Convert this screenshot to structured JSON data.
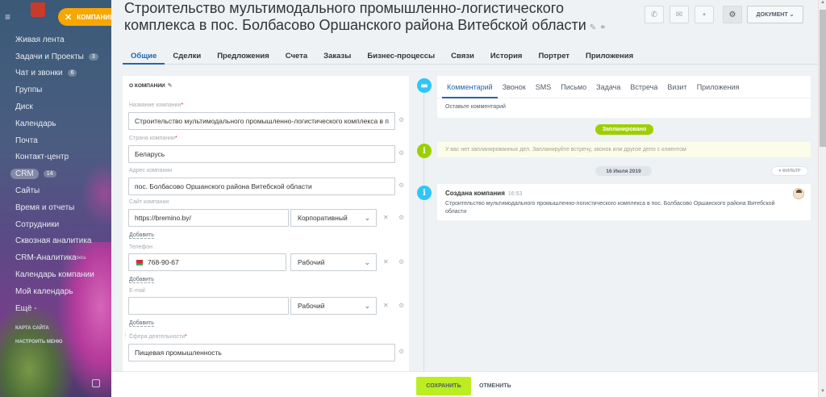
{
  "sidebar": {
    "company_pill": "КОМПАНИЯ",
    "items": [
      {
        "label": "Живая лента",
        "count": ""
      },
      {
        "label": "Задачи и Проекты",
        "count": "3"
      },
      {
        "label": "Чат и звонки",
        "count": "6"
      },
      {
        "label": "Группы",
        "count": ""
      },
      {
        "label": "Диск",
        "count": ""
      },
      {
        "label": "Календарь",
        "count": ""
      },
      {
        "label": "Почта",
        "count": ""
      },
      {
        "label": "Контакт-центр",
        "count": ""
      },
      {
        "label": "CRM",
        "count": "14"
      },
      {
        "label": "Сайты",
        "count": ""
      },
      {
        "label": "Время и отчеты",
        "count": ""
      },
      {
        "label": "Сотрудники",
        "count": ""
      },
      {
        "label": "Сквозная аналитика",
        "count": ""
      },
      {
        "label": "CRM-Аналитика",
        "count": "",
        "sup": "beta"
      },
      {
        "label": "Календарь компании",
        "count": ""
      },
      {
        "label": "Мой календарь",
        "count": ""
      },
      {
        "label": "Ещё -",
        "count": ""
      }
    ],
    "site_map": "КАРТА САЙТА",
    "setup_menu": "НАСТРОИТЬ МЕНЮ"
  },
  "header": {
    "title": "Строительство мультимодального промышленно-логистического комплекса в пос. Болбасово Оршанского района Витебской области",
    "document_button": "ДОКУМЕНТ"
  },
  "tabs": [
    "Общие",
    "Сделки",
    "Предложения",
    "Счета",
    "Заказы",
    "Бизнес-процессы",
    "Связи",
    "История",
    "Портрет",
    "Приложения"
  ],
  "about": {
    "section_title": "О КОМПАНИИ",
    "name_label": "Название компании",
    "name_value": "Строительство мультимодального промышленно-логистического комплекса в п",
    "country_label": "Страна компании",
    "country_value": "Беларусь",
    "address_label": "Адрес компании",
    "address_value": "пос. Болбасово Оршанского района Витебской области",
    "site_label": "Сайт компании",
    "site_value": "https://bremino.by/",
    "site_type": "Корпоративный",
    "add_label": "Добавить",
    "phone_label": "Телефон",
    "phone_value": "768-90-67",
    "phone_type": "Рабочий",
    "email_label": "E-mail",
    "email_value": "",
    "email_type": "Рабочий",
    "industry_label": "Сфера деятельности",
    "industry_value": "Пищевая промышленность"
  },
  "timeline": {
    "comment_tabs": [
      "Комментарий",
      "Звонок",
      "SMS",
      "Письмо",
      "Задача",
      "Встреча",
      "Визит",
      "Приложения"
    ],
    "comment_placeholder": "Оставьте комментарий",
    "planned_label": "Запланировано",
    "planned_empty": "У вас нет запланированных дел. Запланируйте встречу, звонок или другое дело с клиентом",
    "date_label": "16 Июля 2019",
    "filter_label": "ФИЛЬТР",
    "event_title": "Создана компания",
    "event_time": "16:53",
    "event_text": "Строительство мультимодального промышленно-логистического комплекса в пос. Болбасово Оршанского района Витебской области"
  },
  "footer": {
    "save": "СОХРАНИТЬ",
    "cancel": "ОТМЕНИТЬ"
  },
  "colors": {
    "accent_blue": "#2067b0",
    "save_green": "#bbed21",
    "pill_orange": "#f7a700",
    "timeline_blue": "#2fc6f6",
    "timeline_green": "#9dcf00"
  }
}
